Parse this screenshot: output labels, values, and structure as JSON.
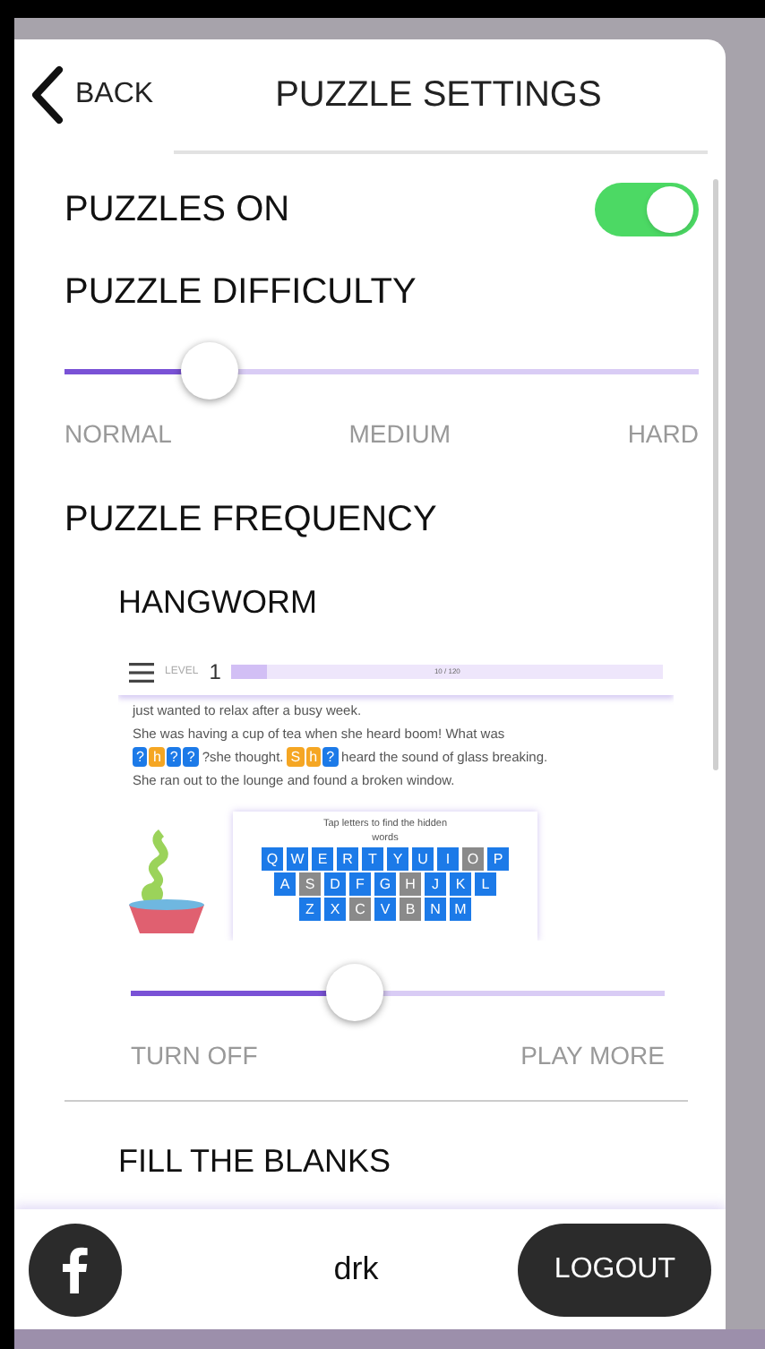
{
  "header": {
    "back_label": "BACK",
    "title": "PUZZLE SETTINGS"
  },
  "puzzles_toggle": {
    "label": "PUZZLES ON",
    "on": true
  },
  "difficulty": {
    "title": "PUZZLE DIFFICULTY",
    "level": 0.23,
    "labels": [
      "NORMAL",
      "MEDIUM",
      "HARD"
    ]
  },
  "frequency": {
    "title": "PUZZLE FREQUENCY",
    "puzzles": [
      {
        "name": "HANGWORM",
        "level": 0.42,
        "labels": [
          "TURN OFF",
          "PLAY MORE"
        ],
        "preview": {
          "level_label": "LEVEL",
          "level_number": "1",
          "progress": "10 / 120",
          "level": 0.08,
          "line_1": "just wanted to relax after a busy week.",
          "line_2": "She was having a cup of tea when she heard boom! What was",
          "word_1": [
            {
              "char": "?",
              "revealed": false
            },
            {
              "char": "h",
              "revealed": true
            },
            {
              "char": "?",
              "revealed": false
            },
            {
              "char": "?",
              "revealed": false
            }
          ],
          "after_word_1": "?she thought.",
          "word_2": [
            {
              "char": "S",
              "revealed": true
            },
            {
              "char": "h",
              "revealed": true
            },
            {
              "char": "?",
              "revealed": false
            }
          ],
          "after_word_2": "heard the sound of glass breaking.",
          "line_4": "She ran out to the lounge and found a broken window.",
          "hint": "Tap letters to find the hidden words",
          "keyboard": [
            [
              {
                "key": "Q",
                "used": false
              },
              {
                "key": "W",
                "used": false
              },
              {
                "key": "E",
                "used": false
              },
              {
                "key": "R",
                "used": false
              },
              {
                "key": "T",
                "used": false
              },
              {
                "key": "Y",
                "used": false
              },
              {
                "key": "U",
                "used": false
              },
              {
                "key": "I",
                "used": false
              },
              {
                "key": "O",
                "used": true
              },
              {
                "key": "P",
                "used": false
              }
            ],
            [
              {
                "key": "A",
                "used": false
              },
              {
                "key": "S",
                "used": true
              },
              {
                "key": "D",
                "used": false
              },
              {
                "key": "F",
                "used": false
              },
              {
                "key": "G",
                "used": false
              },
              {
                "key": "H",
                "used": true
              },
              {
                "key": "J",
                "used": false
              },
              {
                "key": "K",
                "used": false
              },
              {
                "key": "L",
                "used": false
              }
            ],
            [
              {
                "key": "Z",
                "used": false
              },
              {
                "key": "X",
                "used": false
              },
              {
                "key": "C",
                "used": true
              },
              {
                "key": "V",
                "used": false
              },
              {
                "key": "B",
                "used": true
              },
              {
                "key": "N",
                "used": false
              },
              {
                "key": "M",
                "used": false
              }
            ]
          ]
        }
      },
      {
        "name": "FILL THE BLANKS"
      }
    ]
  },
  "footer": {
    "user": "drk",
    "logout": "LOGOUT"
  }
}
